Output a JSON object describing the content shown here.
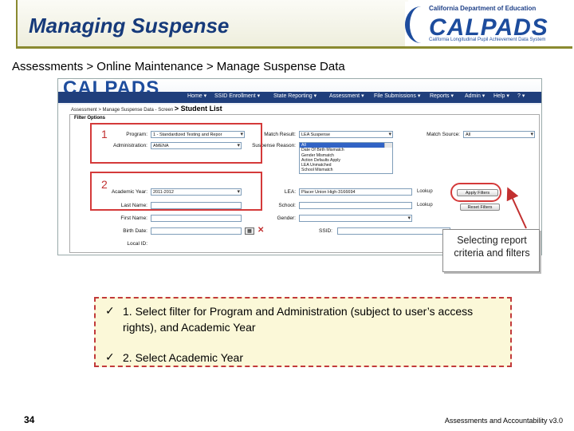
{
  "slide": {
    "title": "Managing Suspense",
    "breadcrumb": "Assessments > Online Maintenance > Manage Suspense Data",
    "page_number": "34",
    "footer": "Assessments and Accountability v3.0"
  },
  "logo": {
    "department": "California Department of Education",
    "wordmark": "CALPADS",
    "tagline": "California Longitudinal Pupil Achievement Data System"
  },
  "app": {
    "logo": "CALPADS",
    "logo_sub": "California Longitudinal Pupil Achievement Data System",
    "nav": [
      "Home ▾",
      "SSID Enrollment ▾",
      "State Reporting ▾",
      "Assessment ▾",
      "File Submissions ▾",
      "Reports ▾",
      "Admin ▾",
      "Help ▾",
      "? ▾"
    ],
    "crumb": "Assessment > Manage Suspense Data - Screen",
    "crumb_current": "> Student List",
    "panel_title": "Filter Options",
    "fields": {
      "program_label": "Program:",
      "program_value": "1 - Standardized Testing and Repor",
      "administration_label": "Administration:",
      "administration_value": "AMENA",
      "match_result_label": "Match Result:",
      "match_result_value": "LEA Suspense",
      "match_source_label": "Match Source:",
      "match_source_value": "All",
      "suspense_reason_label": "Suspense Reason:",
      "suspense_reasons": [
        "All",
        "Date Of Birth Mismatch",
        "Gender Mismatch",
        "Action Defaults Apply",
        "LEA Unmatched",
        "School Mismatch"
      ],
      "academic_year_label": "Academic Year:",
      "academic_year_value": "2011-2012",
      "lea_label": "LEA:",
      "lea_value": "Placer Union High-3166694",
      "lea_lookup": "Lookup",
      "last_name_label": "Last Name:",
      "school_label": "School:",
      "school_lookup": "Lookup",
      "first_name_label": "First Name:",
      "gender_label": "Gender:",
      "birth_date_label": "Birth Date:",
      "ssid_label": "SSID:",
      "local_id_label": "Local ID:"
    },
    "apply_filters": "Apply Filters",
    "reset_filters": "Reset Filters",
    "markers": [
      "1",
      "2"
    ]
  },
  "callout": "Selecting report criteria and filters",
  "notes": [
    "1. Select filter for Program and Administration (subject to user’s access rights), and Academic Year",
    "2. Select Academic Year"
  ],
  "colors": {
    "title": "#163a7a",
    "nav": "#203f7c",
    "highlight": "#d43a3a",
    "notes_bg": "#fbf8d8"
  }
}
